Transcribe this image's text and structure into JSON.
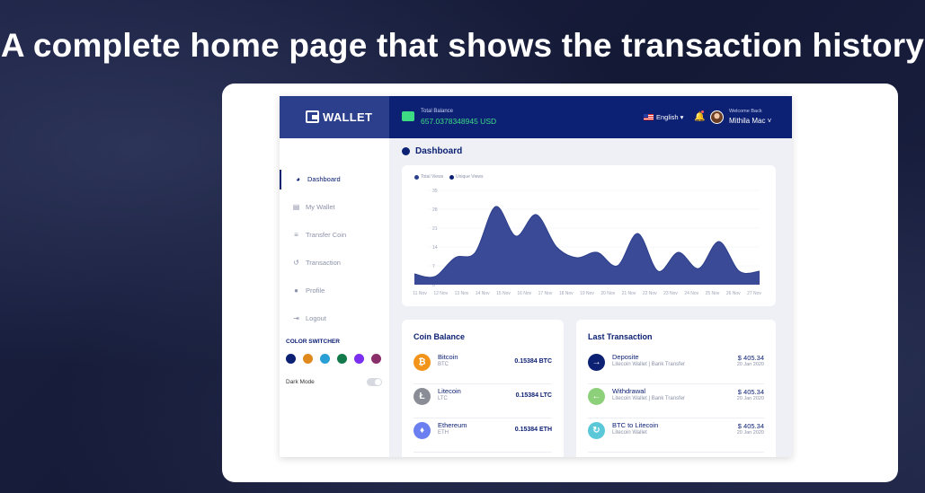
{
  "hero": {
    "title": "A complete home page that shows the transaction history"
  },
  "header": {
    "logo_text": "WALLET",
    "balance_label": "Total Balance",
    "balance_value": "657.0378348945 USD",
    "language": "English ▾",
    "welcome": "Welcome Back",
    "user_name": "Mithila Mac ˅"
  },
  "sidebar": {
    "items": [
      {
        "label": "Dashboard",
        "icon": "dashboard-icon",
        "active": true
      },
      {
        "label": "My Wallet",
        "icon": "wallet-icon"
      },
      {
        "label": "Transfer Coin",
        "icon": "transfer-icon"
      },
      {
        "label": "Transaction",
        "icon": "history-icon"
      },
      {
        "label": "Profile",
        "icon": "user-icon"
      },
      {
        "label": "Logout",
        "icon": "logout-icon"
      }
    ],
    "color_switcher_title": "COLOR SWITCHER",
    "colors": [
      "#0d2174",
      "#e08a1e",
      "#2a9fd6",
      "#127a4a",
      "#7b2ff0",
      "#8b2f6b"
    ],
    "dark_mode_label": "Dark Mode"
  },
  "main": {
    "title": "Dashboard"
  },
  "chart_data": {
    "type": "area",
    "legend": [
      "Total Views",
      "Unique Views"
    ],
    "legend_colors": [
      "#2c3f8c",
      "#0d2174"
    ],
    "x": [
      "11 Nov",
      "12 Nov",
      "13 Nov",
      "14 Nov",
      "15 Nov",
      "16 Nov",
      "17 Nov",
      "18 Nov",
      "19 Nov",
      "20 Nov",
      "21 Nov",
      "22 Nov",
      "23 Nov",
      "24 Nov",
      "25 Nov",
      "26 Nov",
      "27 Nov"
    ],
    "y_ticks": [
      "35",
      "28",
      "21",
      "14",
      "7",
      "0"
    ],
    "ylim": [
      0,
      35
    ],
    "series": [
      {
        "name": "Total Views",
        "values": [
          4,
          3,
          10,
          12,
          29,
          18,
          26,
          14,
          10,
          12,
          7,
          19,
          5,
          12,
          6,
          16,
          5,
          5
        ],
        "color": "#3a4a96"
      }
    ]
  },
  "coin_balance": {
    "title": "Coin Balance",
    "coins": [
      {
        "name": "Bitcoin",
        "symbol": "BTC",
        "amount": "0.15384 BTC",
        "icon": "bitcoin-icon",
        "glyph": "₿",
        "color": "#f2931a"
      },
      {
        "name": "Litecoin",
        "symbol": "LTC",
        "amount": "0.15384 LTC",
        "icon": "litecoin-icon",
        "glyph": "Ł",
        "color": "#8a8d95"
      },
      {
        "name": "Ethereum",
        "symbol": "ETH",
        "amount": "0.15384 ETH",
        "icon": "ethereum-icon",
        "glyph": "♦",
        "color": "#6b7ff0"
      }
    ]
  },
  "last_transaction": {
    "title": "Last Transaction",
    "items": [
      {
        "title": "Deposite",
        "subtitle": "Litecoin Wallet | Bank Transfer",
        "amount": "$ 405.34",
        "date": "20 Jan 2020",
        "icon": "arrow-right-icon",
        "glyph": "→",
        "color": "#0d2174"
      },
      {
        "title": "Withdrawal",
        "subtitle": "Litecoin Wallet | Bank Transfer",
        "amount": "$ 405.34",
        "date": "20 Jan 2020",
        "icon": "arrow-left-icon",
        "glyph": "←",
        "color": "#8dd07a"
      },
      {
        "title": "BTC to Litecoin",
        "subtitle": "Litecoin Wallet",
        "amount": "$ 405.34",
        "date": "20 Jan 2020",
        "icon": "exchange-icon",
        "glyph": "↻",
        "color": "#5ac8d8"
      }
    ]
  }
}
